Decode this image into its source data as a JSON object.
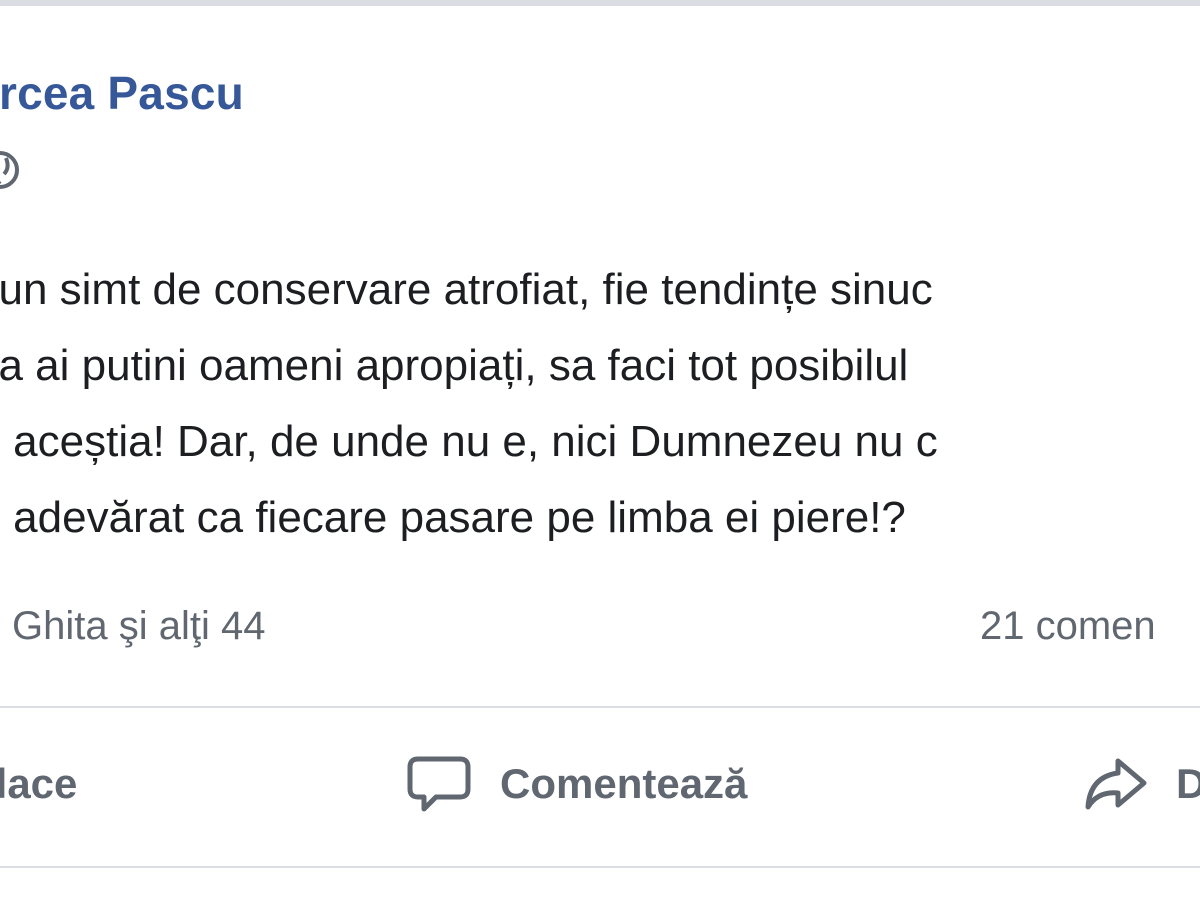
{
  "post": {
    "author": "ircea Pascu",
    "lines": [
      "ai un simt de conservare atrofiat, fie tendințe sinuc",
      "așa ai putini oameni apropiați, sa faci tot posibilul",
      "pe aceștia! Dar, de unde nu e, nici Dumnezeu nu c",
      "de adevărat ca fiecare pasare pe limba ei piere!?"
    ],
    "reactions_text": "Ghita şi alţi 44",
    "comments_count_text": "21 comen"
  },
  "actions": {
    "like_label": "place",
    "comment_label": "Comentează",
    "share_label": "D"
  },
  "colors": {
    "author": "#365899",
    "text": "#1c1e21",
    "muted": "#606770",
    "divider": "#dadde1"
  },
  "icons": {
    "privacy": "globe-icon",
    "comment": "comment-icon",
    "share": "share-icon"
  }
}
